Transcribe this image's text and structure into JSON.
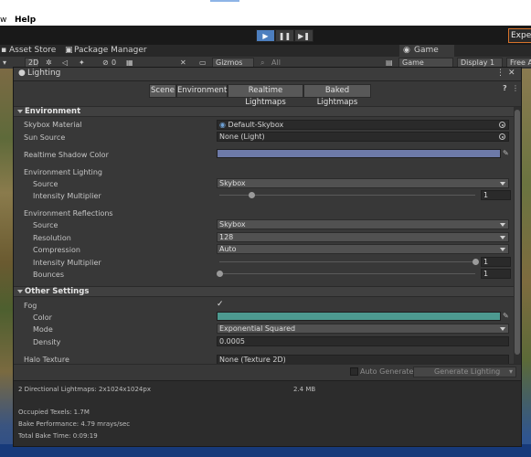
{
  "menubar": {
    "items": [
      "w",
      "Help"
    ]
  },
  "toolbar": {
    "expert_label": "Exper"
  },
  "tabs": {
    "asset_store": "Asset Store",
    "package_manager": "Package Manager",
    "game": "Game"
  },
  "scenebar": {
    "mode_2d": "2D",
    "gizmos": "Gizmos",
    "search_placeholder": "All",
    "game_display": "Game",
    "display": "Display 1",
    "free_aspect": "Free A",
    "hidden_count": "0"
  },
  "lighting": {
    "title": "Lighting",
    "tabs": [
      "Scene",
      "Environment",
      "Realtime Lightmaps",
      "Baked Lightmaps"
    ],
    "active_tab": "Environment",
    "environment": {
      "header": "Environment",
      "skybox_label": "Skybox Material",
      "skybox_value": "Default-Skybox",
      "sun_label": "Sun Source",
      "sun_value": "None (Light)",
      "shadow_label": "Realtime Shadow Color",
      "shadow_color": "#6d7aa8",
      "env_lighting_label": "Environment Lighting",
      "source_label": "Source",
      "source_value": "Skybox",
      "intensity_label": "Intensity Multiplier",
      "intensity_value": "1",
      "intensity_fraction": 0.125,
      "env_reflections_label": "Environment Reflections",
      "refl_source_label": "Source",
      "refl_source_value": "Skybox",
      "resolution_label": "Resolution",
      "resolution_value": "128",
      "compression_label": "Compression",
      "compression_value": "Auto",
      "refl_intensity_label": "Intensity Multiplier",
      "refl_intensity_value": "1",
      "refl_intensity_fraction": 1.0,
      "bounces_label": "Bounces",
      "bounces_value": "1",
      "bounces_fraction": 0.0
    },
    "other": {
      "header": "Other Settings",
      "fog_label": "Fog",
      "fog_checked": "✓",
      "color_label": "Color",
      "fog_color": "#4d9a90",
      "mode_label": "Mode",
      "mode_value": "Exponential Squared",
      "density_label": "Density",
      "density_value": "0.0005",
      "halo_label": "Halo Texture",
      "halo_value": "None (Texture 2D)"
    },
    "auto_generate_label": "Auto Generate",
    "generate_label": "Generate Lighting",
    "stats": {
      "lightmaps": "2 Directional Lightmaps: 2x1024x1024px",
      "size": "2.4 MB",
      "texels": "Occupied Texels: 1.7M",
      "performance": "Bake Performance: 4.79 mrays/sec",
      "bake_time": "Total Bake Time: 0:09:19"
    }
  },
  "colors": {
    "accent": "#4d7fbf",
    "expert_border": "#d8732a"
  }
}
